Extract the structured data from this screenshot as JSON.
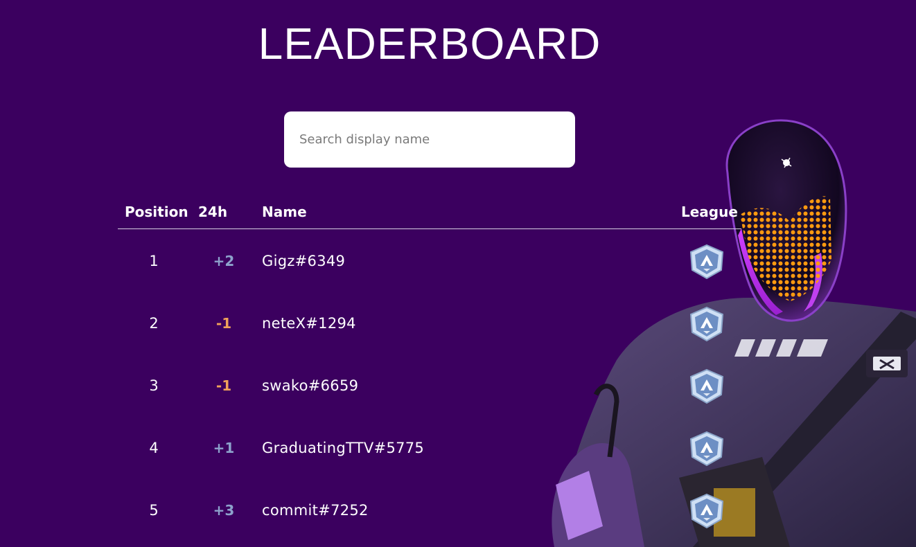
{
  "page": {
    "title": "LEADERBOARD"
  },
  "search": {
    "placeholder": "Search display name",
    "value": ""
  },
  "table": {
    "headers": {
      "position": "Position",
      "change": "24h",
      "name": "Name",
      "league": "League"
    },
    "rows": [
      {
        "position": "1",
        "change": "+2",
        "direction": "up",
        "name": "Gigz#6349",
        "league_icon": "league-badge-icon"
      },
      {
        "position": "2",
        "change": "-1",
        "direction": "down",
        "name": "neteX#1294",
        "league_icon": "league-badge-icon"
      },
      {
        "position": "3",
        "change": "-1",
        "direction": "down",
        "name": "swako#6659",
        "league_icon": "league-badge-icon"
      },
      {
        "position": "4",
        "change": "+1",
        "direction": "up",
        "name": "GraduatingTTV#5775",
        "league_icon": "league-badge-icon"
      },
      {
        "position": "5",
        "change": "+3",
        "direction": "up",
        "name": "commit#7252",
        "league_icon": "league-badge-icon"
      }
    ]
  },
  "colors": {
    "background": "#3b005f",
    "positive_change": "#8da2cc",
    "negative_change": "#f0a25a"
  }
}
